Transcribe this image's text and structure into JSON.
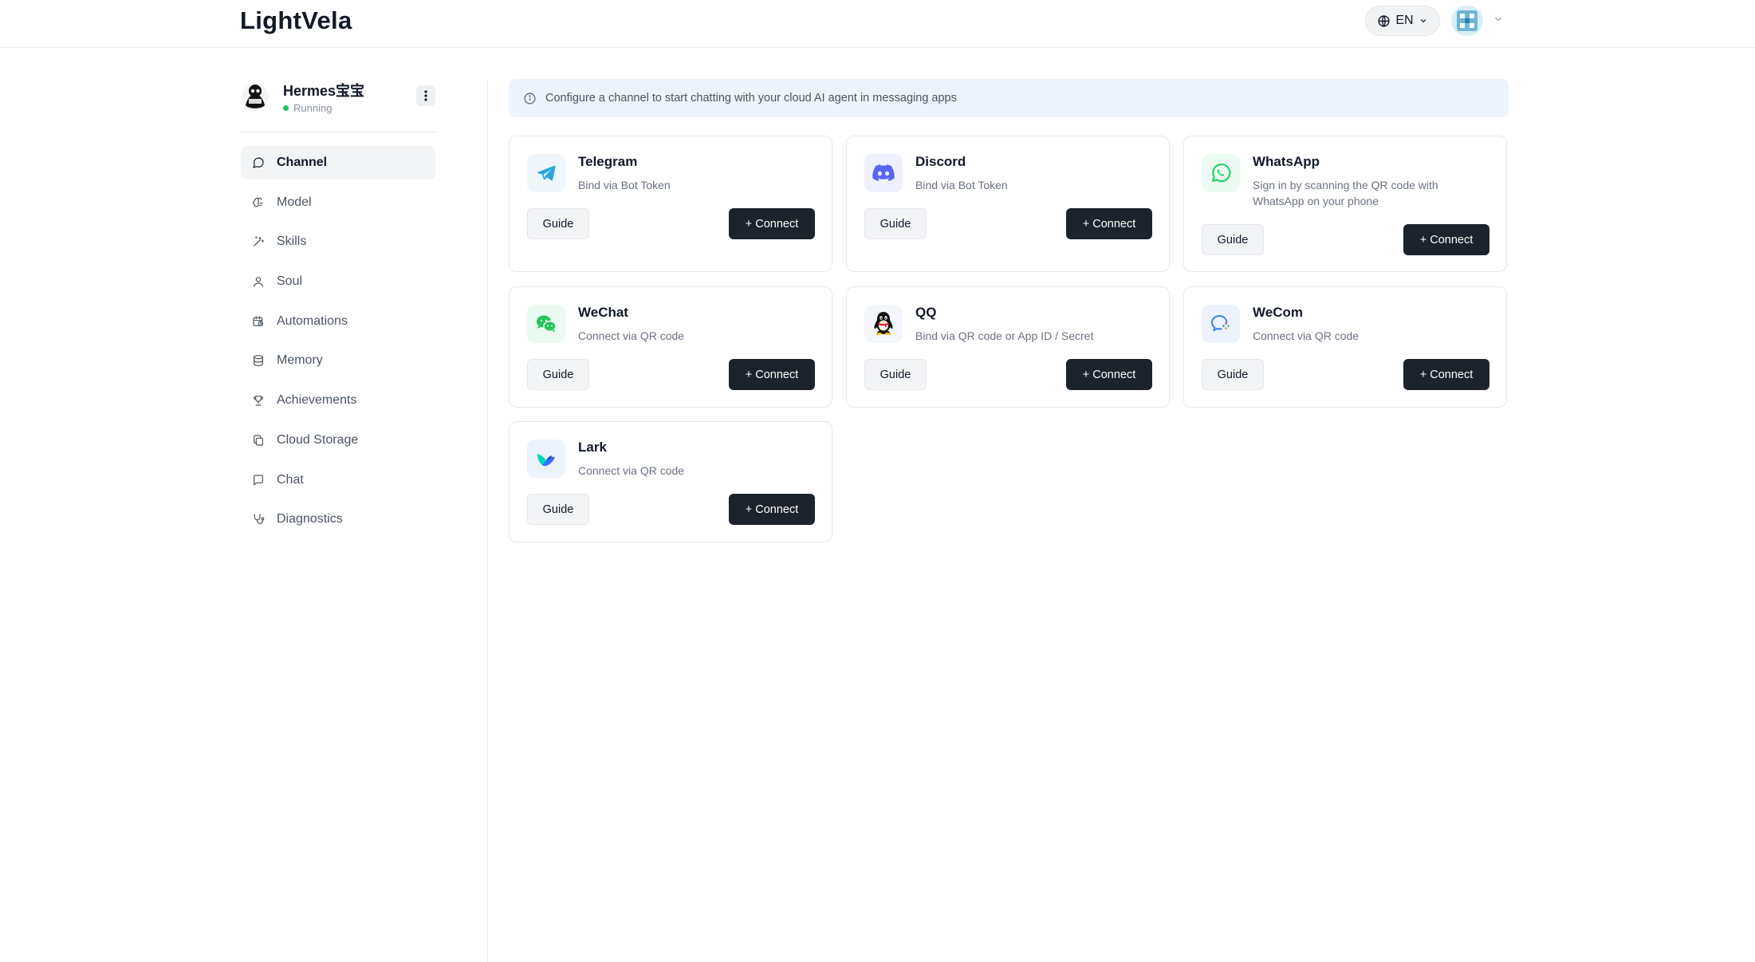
{
  "header": {
    "logo": "LightVela",
    "language": "EN"
  },
  "agent": {
    "name": "Hermes宝宝",
    "status": "Running",
    "status_color": "#22c55e"
  },
  "sidebar": {
    "items": [
      {
        "label": "Channel",
        "icon": "chat-bubble-icon",
        "active": true
      },
      {
        "label": "Model",
        "icon": "brain-icon"
      },
      {
        "label": "Skills",
        "icon": "magic-wand-icon"
      },
      {
        "label": "Soul",
        "icon": "user-icon"
      },
      {
        "label": "Automations",
        "icon": "calendar-clock-icon"
      },
      {
        "label": "Memory",
        "icon": "database-icon"
      },
      {
        "label": "Achievements",
        "icon": "trophy-icon"
      },
      {
        "label": "Cloud Storage",
        "icon": "copy-files-icon"
      },
      {
        "label": "Chat",
        "icon": "message-square-icon"
      },
      {
        "label": "Diagnostics",
        "icon": "stethoscope-icon"
      }
    ]
  },
  "banner": {
    "text": "Configure a channel to start chatting with your cloud AI agent in messaging apps"
  },
  "channels": [
    {
      "name": "Telegram",
      "desc": "Bind via Bot Token",
      "icon": "telegram-icon",
      "guide": "Guide",
      "connect": "+ Connect"
    },
    {
      "name": "Discord",
      "desc": "Bind via Bot Token",
      "icon": "discord-icon",
      "guide": "Guide",
      "connect": "+ Connect"
    },
    {
      "name": "WhatsApp",
      "desc": "Sign in by scanning the QR code with WhatsApp on your phone",
      "icon": "whatsapp-icon",
      "guide": "Guide",
      "connect": "+ Connect"
    },
    {
      "name": "WeChat",
      "desc": "Connect via QR code",
      "icon": "wechat-icon",
      "guide": "Guide",
      "connect": "+ Connect"
    },
    {
      "name": "QQ",
      "desc": "Bind via QR code or App ID / Secret",
      "icon": "qq-icon",
      "guide": "Guide",
      "connect": "+ Connect"
    },
    {
      "name": "WeCom",
      "desc": "Connect via QR code",
      "icon": "wecom-icon",
      "guide": "Guide",
      "connect": "+ Connect"
    },
    {
      "name": "Lark",
      "desc": "Connect via QR code",
      "icon": "lark-icon",
      "guide": "Guide",
      "connect": "+ Connect"
    }
  ],
  "colors": {
    "primary_button": "#1d232c",
    "banner_bg": "#edf4fd",
    "telegram": "#2aa3df",
    "discord": "#5865f2",
    "whatsapp": "#25d366",
    "wechat": "#22c55e",
    "wecom": "#3b82f6"
  }
}
